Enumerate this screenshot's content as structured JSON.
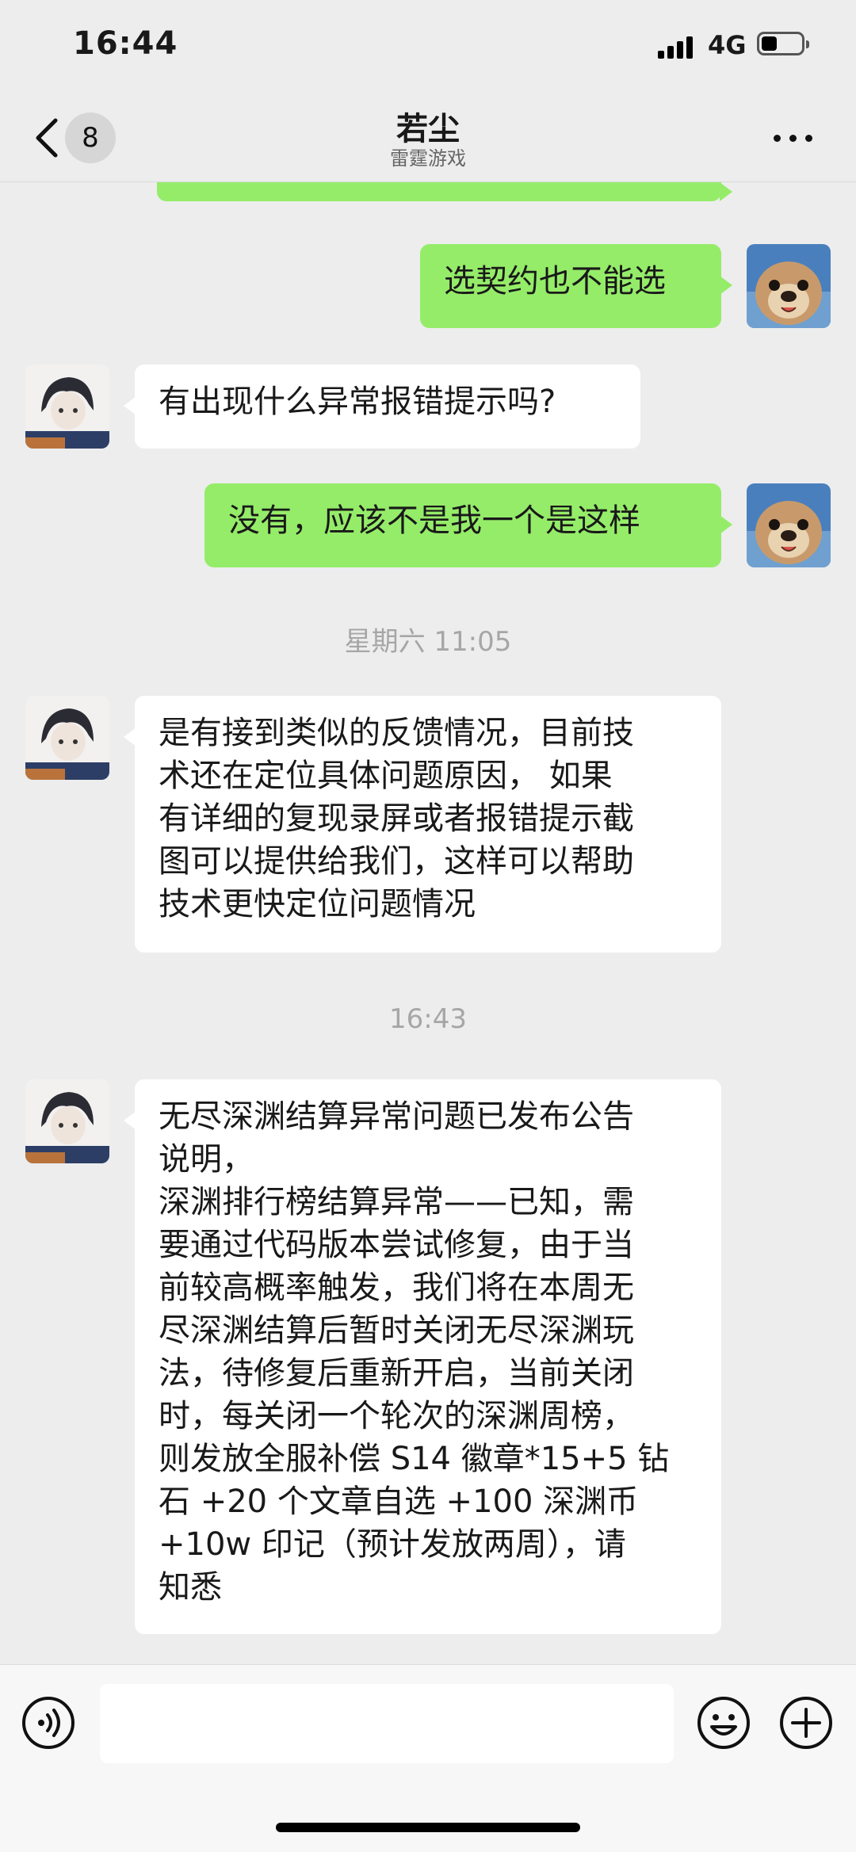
{
  "status": {
    "time": "16:44",
    "network": "4G"
  },
  "nav": {
    "back_count": "8",
    "title": "若尘",
    "subtitle": "雷霆游戏"
  },
  "messages": [
    {
      "side": "out",
      "text": "选契约也不能选"
    },
    {
      "side": "in",
      "text": "有出现什么异常报错提示吗?"
    },
    {
      "side": "out",
      "text": "没有，应该不是我一个是这样"
    },
    {
      "type": "time",
      "text": "星期六 11:05"
    },
    {
      "side": "in",
      "text": "是有接到类似的反馈情况，目前技\n术还在定位具体问题原因， 如果\n有详细的复现录屏或者报错提示截\n图可以提供给我们，这样可以帮助\n技术更快定位问题情况"
    },
    {
      "type": "time",
      "text": "16:43"
    },
    {
      "side": "in",
      "text": "无尽深渊结算异常问题已发布公告\n说明，\n深渊排行榜结算异常——已知，需\n要通过代码版本尝试修复，由于当\n前较高概率触发，我们将在本周无\n尽深渊结算后暂时关闭无尽深渊玩\n法，待修复后重新开启，当前关闭\n时，每关闭一个轮次的深渊周榜，\n则发放全服补偿 S14 徽章*15+5 钻\n石 +20 个文章自选 +100 深渊币\n+10w 印记（预计发放两周），请\n知悉"
    }
  ],
  "icons": {
    "back": "chevron-left-icon",
    "more": "more-dots-icon",
    "voice": "voice-icon",
    "emoji": "emoji-icon",
    "plus": "plus-icon"
  },
  "colors": {
    "outgoing_bubble": "#95ec69",
    "incoming_bubble": "#ffffff",
    "background": "#ededed"
  }
}
